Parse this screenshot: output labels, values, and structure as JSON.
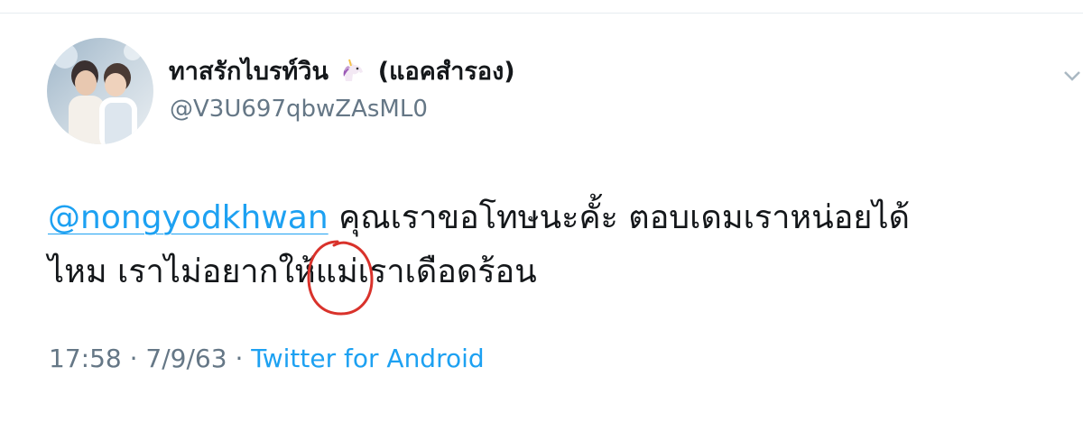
{
  "tweet": {
    "display_name": "ทาสรักไบรท์วิน",
    "display_name_suffix": "(แอคสำรอง)",
    "name_emoji": "unicorn-icon",
    "handle": "@V3U697qbwZAsML0",
    "mention": "@nongyodkhwan",
    "text_line1": "คุณเราขอโทษนะคั้ะ ตอบเดมเราหน่อยได้",
    "text_line2_before": "ไหม เราไม่อยาก",
    "text_line2_circled": "ให้",
    "text_line2_after": "แม่เราเดือดร้อน",
    "time": "17:58",
    "date": "7/9/63",
    "separator": "·",
    "source": "Twitter for Android"
  },
  "colors": {
    "link": "#1da1f2",
    "text": "#14171a",
    "muted": "#657786",
    "annotation": "#d9322b"
  }
}
